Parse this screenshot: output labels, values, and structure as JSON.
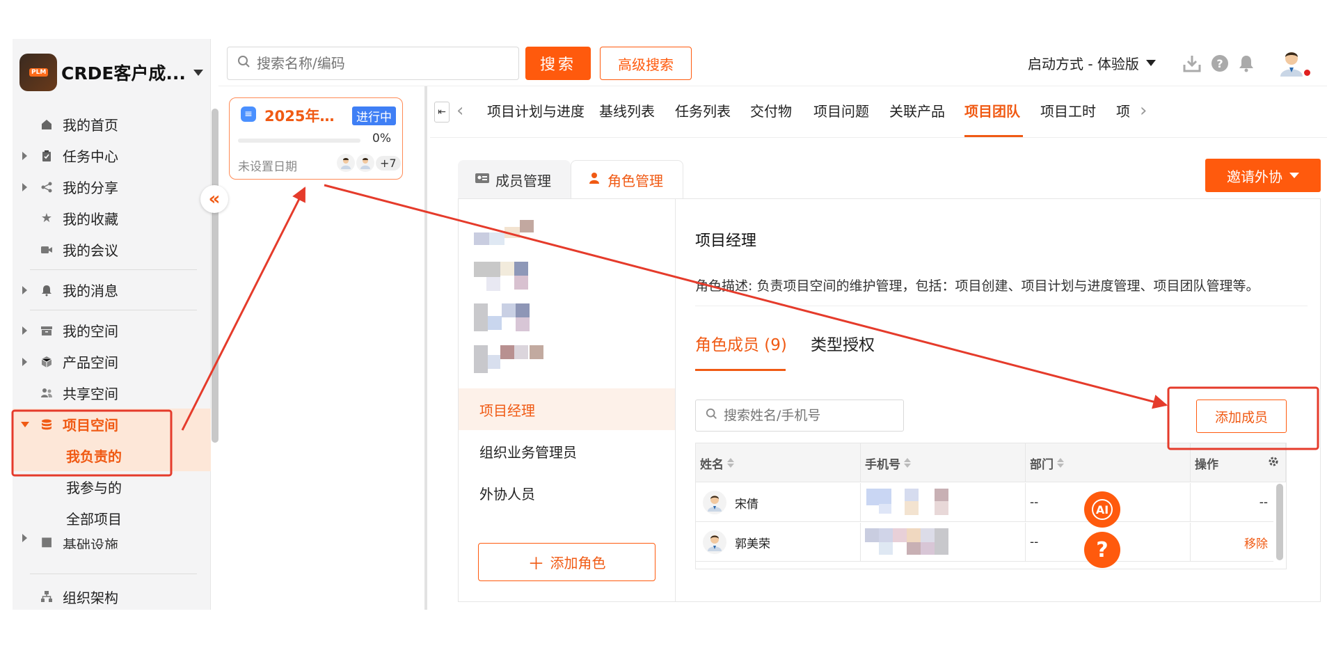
{
  "brand": {
    "title": "CRDE客户成...",
    "logo_text": "PLM"
  },
  "sidebar": {
    "items": [
      {
        "label": "我的首页",
        "icon": "home-icon"
      },
      {
        "label": "任务中心",
        "icon": "clipboard-icon"
      },
      {
        "label": "我的分享",
        "icon": "share-icon"
      },
      {
        "label": "我的收藏",
        "icon": "star-icon"
      },
      {
        "label": "我的会议",
        "icon": "video-icon"
      },
      {
        "label": "我的消息",
        "icon": "bell-icon"
      },
      {
        "label": "我的空间",
        "icon": "archive-icon"
      },
      {
        "label": "产品空间",
        "icon": "cube-icon"
      },
      {
        "label": "共享空间",
        "icon": "users-icon"
      },
      {
        "label": "项目空间",
        "icon": "database-icon"
      }
    ],
    "sub_items": [
      "我负责的",
      "我参与的",
      "全部项目",
      "基础设施"
    ],
    "bottom_item": "组织架构"
  },
  "topbar": {
    "search_placeholder": "搜索名称/编码",
    "search_button": "搜索",
    "advanced_search": "高级搜索",
    "launch_mode": "启动方式 - 体验版"
  },
  "project_card": {
    "title": "2025年【...",
    "status": "进行中",
    "progress": 0,
    "progress_text": "0%",
    "date": "未设置日期",
    "extra_members": "+7"
  },
  "tabs": [
    "项目计划与进度",
    "基线列表",
    "任务列表",
    "交付物",
    "项目问题",
    "关联产品",
    "项目团队",
    "项目工时",
    "项目"
  ],
  "active_tab": "项目团队",
  "subtabs": [
    "成员管理",
    "角色管理"
  ],
  "invite_button": "邀请外协",
  "roles": [
    "项目经理",
    "组织业务管理员",
    "外协人员"
  ],
  "add_role": "添加角色",
  "role_detail": {
    "title": "项目经理",
    "description": "角色描述: 负责项目空间的维护管理，包括：项目创建、项目计划与进度管理、项目团队管理等。",
    "tabs": [
      "角色成员 (9)",
      "类型授权"
    ],
    "member_search_placeholder": "搜索姓名/手机号",
    "add_member": "添加成员"
  },
  "table": {
    "columns": [
      "姓名",
      "手机号",
      "部门",
      "操作"
    ],
    "rows": [
      {
        "name": "宋倩",
        "dept": "--",
        "action": "--"
      },
      {
        "name": "郭美荣",
        "dept": "--",
        "action": "移除"
      }
    ]
  },
  "floating": {
    "ai_label": "AI",
    "help_label": "?"
  },
  "colors": {
    "accent": "#ff5a0d",
    "accent_text": "#f05a14",
    "status_blue": "#3f7ff5",
    "annotation_red": "#e53b2b"
  }
}
